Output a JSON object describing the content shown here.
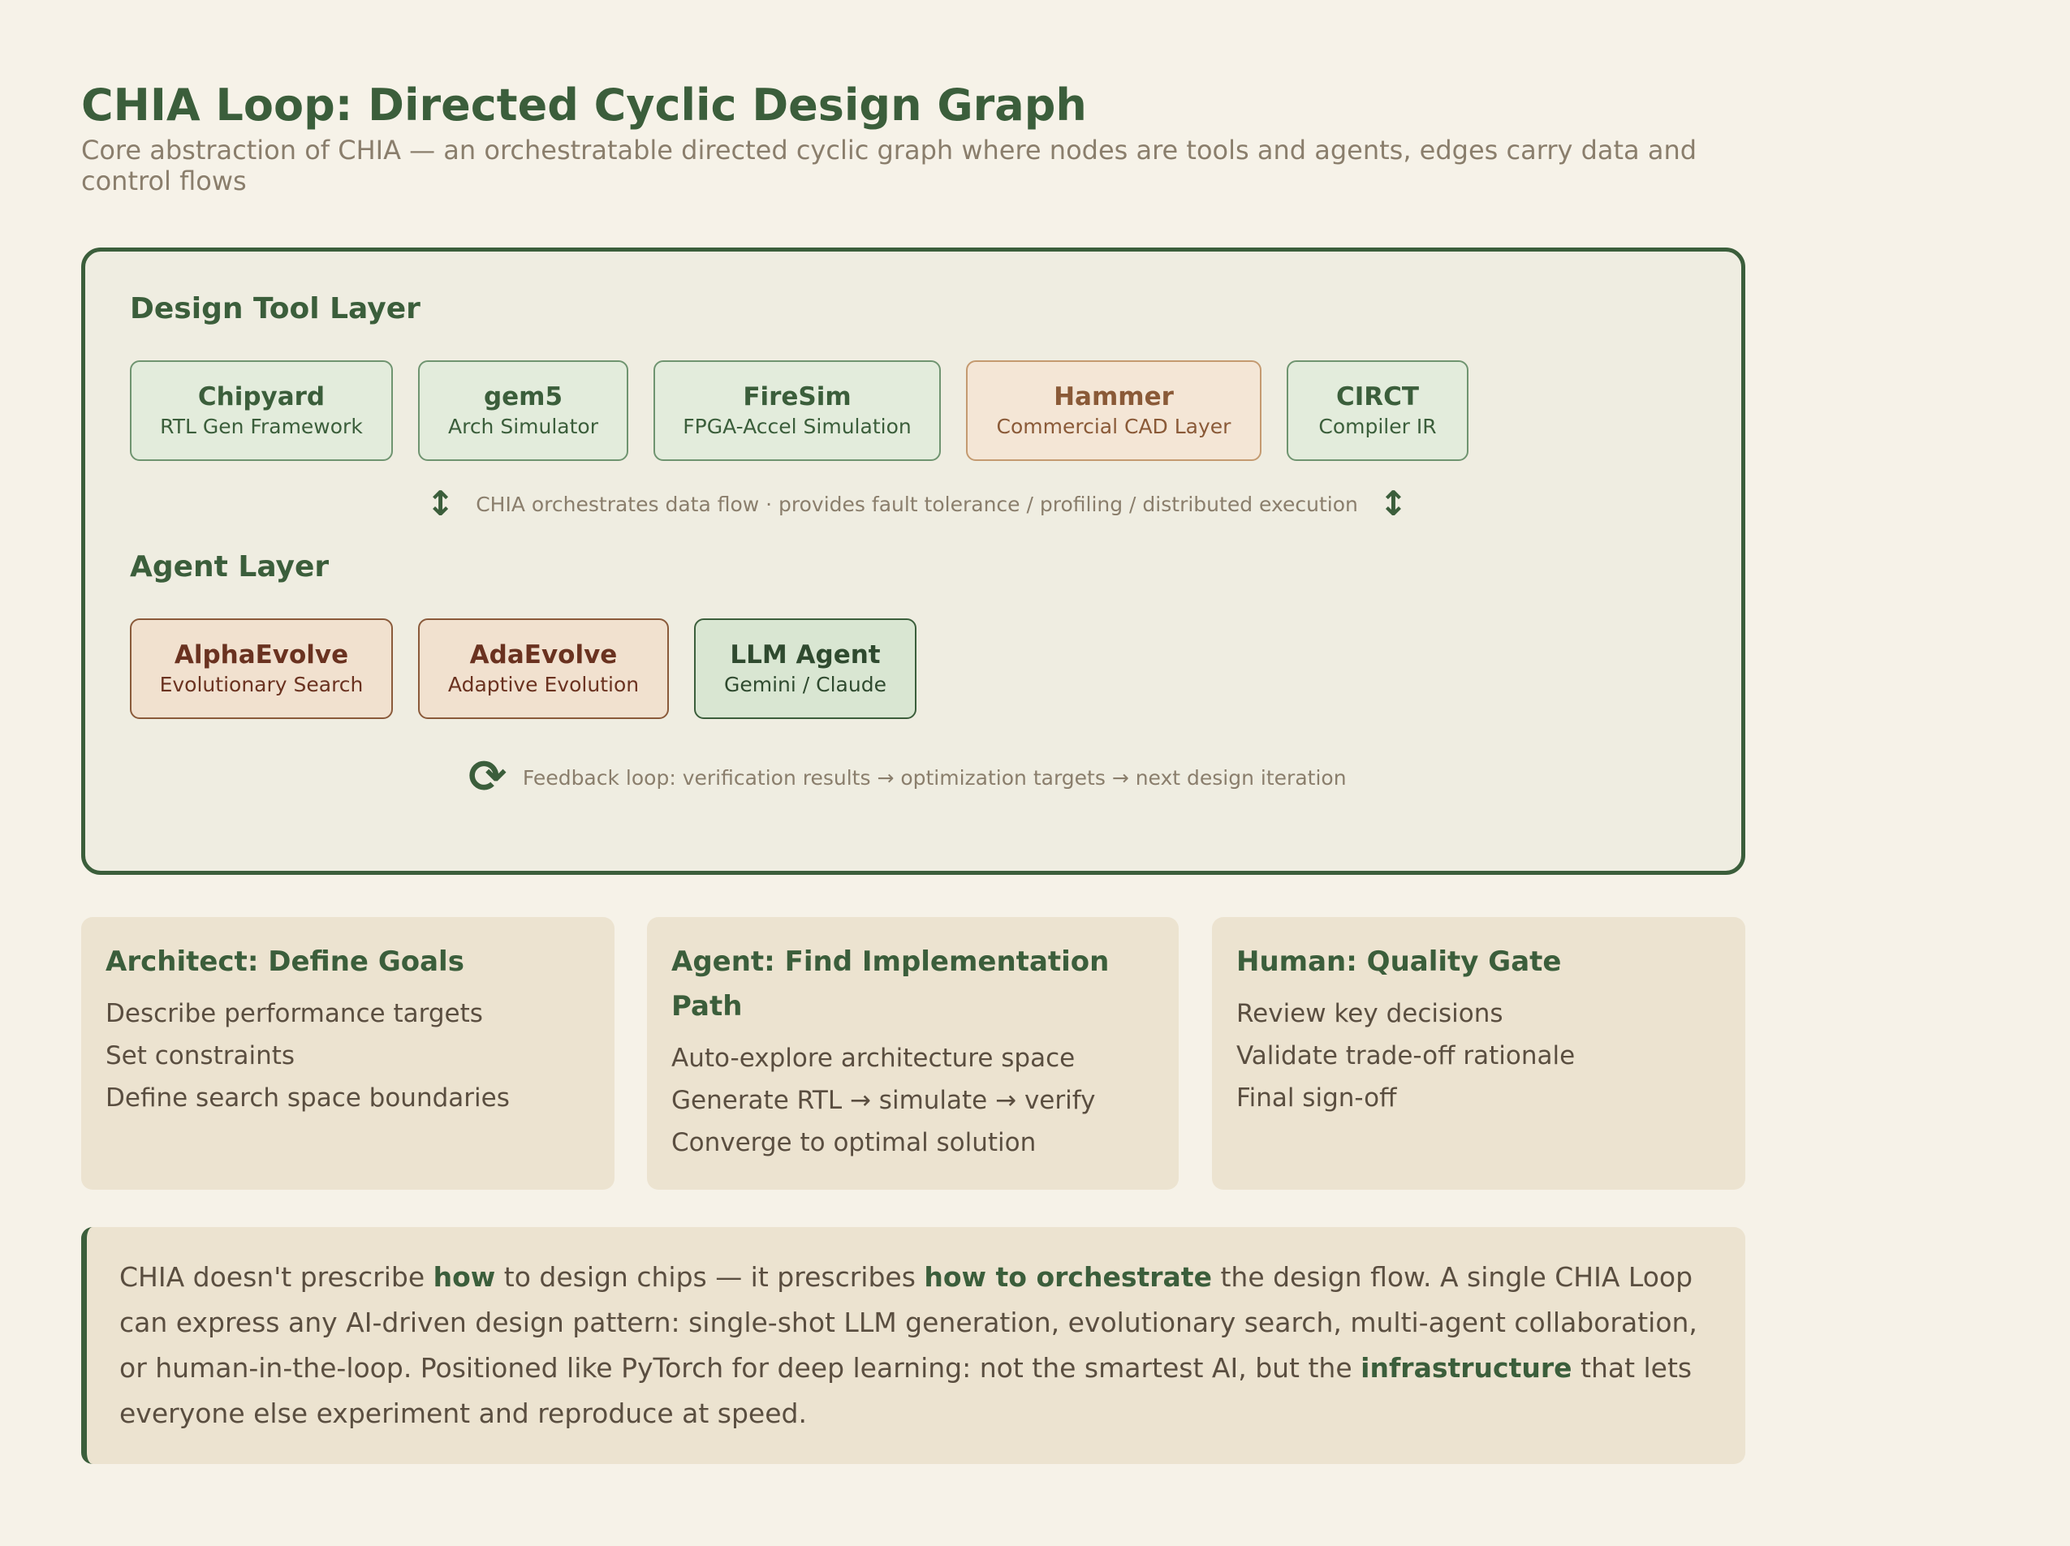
{
  "header": {
    "title": "CHIA Loop: Directed Cyclic Design Graph",
    "subtitle": "Core abstraction of CHIA — an orchestratable directed cyclic graph where nodes are tools and agents, edges carry data and control flows"
  },
  "design_layer": {
    "title": "Design Tool Layer",
    "nodes": [
      {
        "name": "Chipyard",
        "desc": "RTL Gen Framework"
      },
      {
        "name": "gem5",
        "desc": "Arch Simulator"
      },
      {
        "name": "FireSim",
        "desc": "FPGA-Accel Simulation"
      },
      {
        "name": "Hammer",
        "desc": "Commercial CAD Layer"
      },
      {
        "name": "CIRCT",
        "desc": "Compiler IR"
      }
    ]
  },
  "orchestration": {
    "icon": "↕",
    "text": "CHIA orchestrates data flow · provides fault tolerance / profiling / distributed execution"
  },
  "agent_layer": {
    "title": "Agent Layer",
    "nodes": [
      {
        "name": "AlphaEvolve",
        "desc": "Evolutionary Search"
      },
      {
        "name": "AdaEvolve",
        "desc": "Adaptive Evolution"
      },
      {
        "name": "LLM Agent",
        "desc": "Gemini / Claude"
      }
    ]
  },
  "feedback": {
    "icon": "⟳",
    "text": "Feedback loop: verification results → optimization targets → next design iteration"
  },
  "roles": [
    {
      "title": "Architect: Define Goals",
      "items": [
        "Describe performance targets",
        "Set constraints",
        "Define search space boundaries"
      ]
    },
    {
      "title": "Agent: Find Implementation Path",
      "items": [
        "Auto-explore architecture space",
        "Generate RTL → simulate → verify",
        "Converge to optimal solution"
      ]
    },
    {
      "title": "Human: Quality Gate",
      "items": [
        "Review key decisions",
        "Validate trade-off rationale",
        "Final sign-off"
      ]
    }
  ],
  "note": {
    "p1": "CHIA doesn't prescribe ",
    "b1": "how",
    "p2": " to design chips — it prescribes ",
    "b2": "how to orchestrate",
    "p3": " the design flow. A single CHIA Loop can express any AI-driven design pattern: single-shot LLM generation, evolutionary search, multi-agent collaboration, or human-in-the-loop. Positioned like PyTorch for deep learning: not the smartest AI, but the ",
    "b3": "infrastructure",
    "p4": " that lets everyone else experiment and reproduce at speed."
  }
}
